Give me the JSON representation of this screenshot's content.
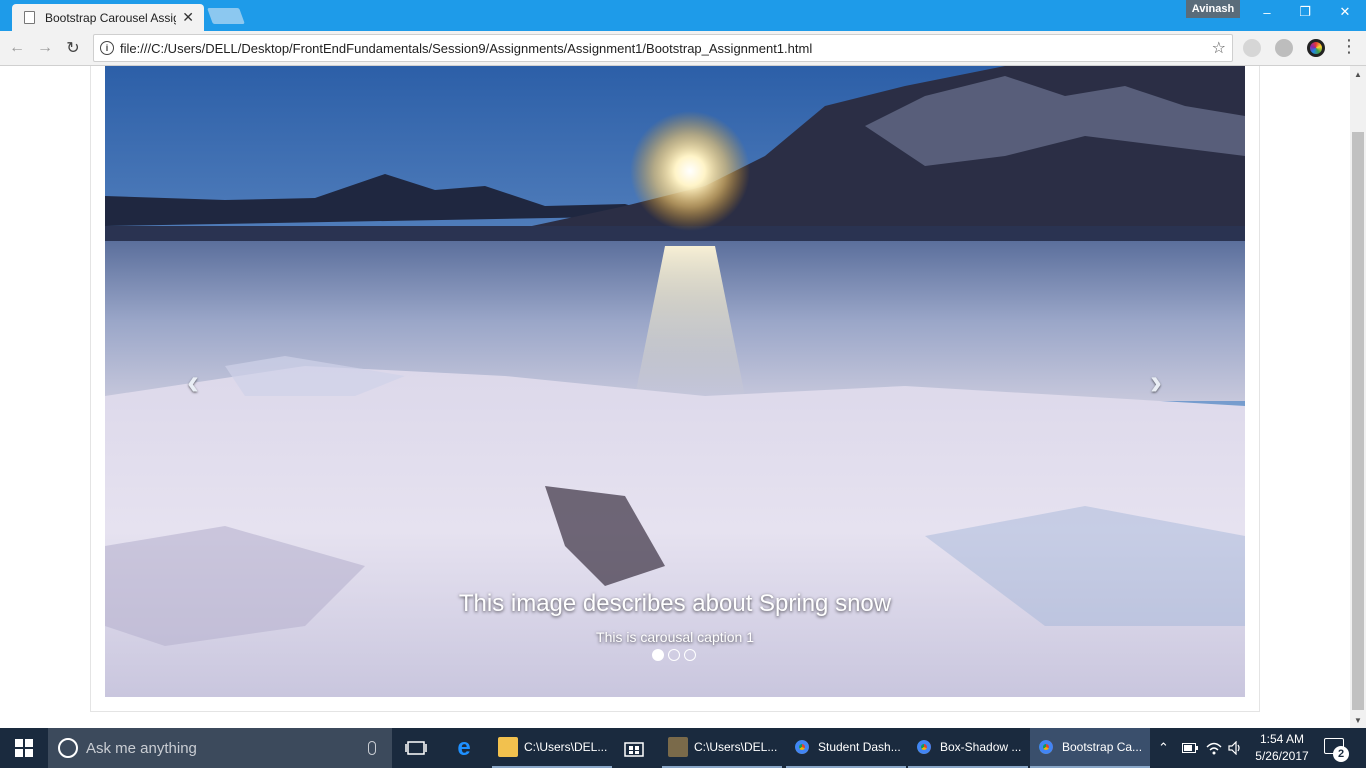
{
  "browser": {
    "tab_title": "Bootstrap Carousel Assig",
    "profile_name": "Avinash",
    "url": "file:///C:/Users/DELL/Desktop/FrontEndFundamentals/Session9/Assignments/Assignment1/Bootstrap_Assignment1.html",
    "window_controls": {
      "minimize": "–",
      "restore": "❐",
      "close": "✕"
    }
  },
  "carousel": {
    "caption_title": "This image describes about Spring snow",
    "caption_text": "This is carousal caption 1",
    "prev_glyph": "‹",
    "next_glyph": "›",
    "indicator_count": 3,
    "active_index": 0
  },
  "taskbar": {
    "search_placeholder": "Ask me anything",
    "apps": [
      {
        "label": "C:\\Users\\DEL...",
        "icon": "folder-icon",
        "color": "#f2c14e"
      },
      {
        "label": "C:\\Users\\DEL...",
        "icon": "sublime-icon",
        "color": "#7a6a4a"
      },
      {
        "label": "Student Dash...",
        "icon": "chrome-icon",
        "color": "#db4437"
      },
      {
        "label": "Box-Shadow ...",
        "icon": "chrome-icon",
        "color": "#db4437"
      },
      {
        "label": "Bootstrap Ca...",
        "icon": "chrome-icon",
        "color": "#db4437"
      }
    ],
    "time": "1:54 AM",
    "date": "5/26/2017",
    "notification_count": "2"
  }
}
